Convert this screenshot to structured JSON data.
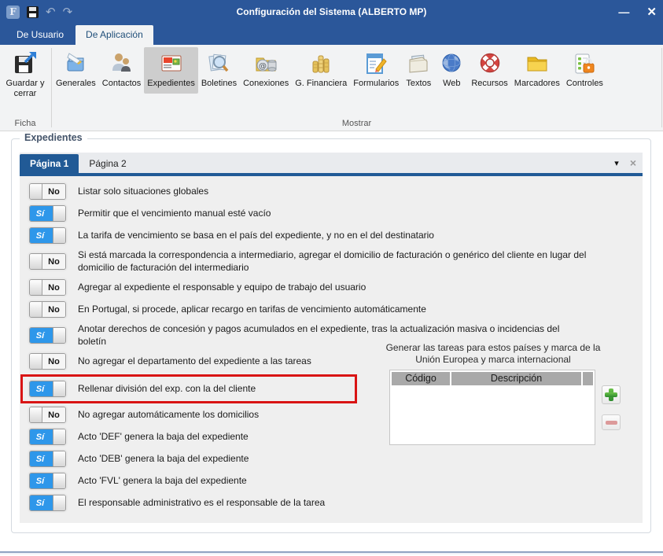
{
  "window": {
    "title": "Configuración del Sistema (ALBERTO MP)",
    "app_logo_glyph": "F",
    "undo_glyph": "↶",
    "redo_glyph": "↷",
    "minimize_glyph": "—",
    "close_glyph": "✕"
  },
  "ribbon_tabs": [
    {
      "label": "De Usuario",
      "active": false
    },
    {
      "label": "De Aplicación",
      "active": true
    }
  ],
  "ribbon": {
    "ficha_group": {
      "group_label": "Ficha",
      "button_label": "Guardar y cerrar",
      "button_icon": "save-close-icon"
    },
    "show_group": {
      "group_label": "Mostrar",
      "buttons": [
        {
          "label": "Generales",
          "icon": "notes-icon",
          "selected": false
        },
        {
          "label": "Contactos",
          "icon": "people-icon",
          "selected": false
        },
        {
          "label": "Expedientes",
          "icon": "card-icon",
          "selected": true
        },
        {
          "label": "Boletines",
          "icon": "magnifier-icon",
          "selected": false
        },
        {
          "label": "Conexiones",
          "icon": "connection-icon",
          "selected": false
        },
        {
          "label": "G. Financiera",
          "icon": "coins-icon",
          "selected": false
        },
        {
          "label": "Formularios",
          "icon": "form-icon",
          "selected": false
        },
        {
          "label": "Textos",
          "icon": "texts-icon",
          "selected": false
        },
        {
          "label": "Web",
          "icon": "globe-icon",
          "selected": false
        },
        {
          "label": "Recursos",
          "icon": "lifesaver-icon",
          "selected": false
        },
        {
          "label": "Marcadores",
          "icon": "folder-icon",
          "selected": false
        },
        {
          "label": "Controles",
          "icon": "lock-list-icon",
          "selected": false
        }
      ]
    }
  },
  "panel": {
    "title": "Expedientes",
    "page_tabs": [
      {
        "label": "Página 1",
        "active": true
      },
      {
        "label": "Página 2",
        "active": false
      }
    ],
    "tab_menu_glyph": "▾",
    "tab_close_glyph": "×",
    "settings": [
      {
        "state": "No",
        "label": "Listar solo situaciones globales",
        "highlighted": false
      },
      {
        "state": "Sí",
        "label": "Permitir que el vencimiento manual esté vacío",
        "highlighted": false
      },
      {
        "state": "Sí",
        "label": "La tarifa de vencimiento se basa en el país del expediente, y no en el del destinatario",
        "highlighted": false
      },
      {
        "state": "No",
        "label": "Si está marcada la correspondencia a intermediario, agregar el domicilio de facturación o genérico del cliente en lugar del domicilio de facturación del intermediario",
        "highlighted": false
      },
      {
        "state": "No",
        "label": "Agregar al expediente el responsable y equipo de trabajo del usuario",
        "highlighted": false
      },
      {
        "state": "No",
        "label": "En Portugal, si procede, aplicar recargo en tarifas de vencimiento automáticamente",
        "highlighted": false
      },
      {
        "state": "Sí",
        "label": "Anotar derechos de concesión y pagos acumulados en el expediente, tras la actualización masiva o incidencias del boletín",
        "highlighted": false
      },
      {
        "state": "No",
        "label": "No agregar el departamento del expediente a las tareas",
        "highlighted": false
      },
      {
        "state": "Sí",
        "label": "Rellenar división del exp. con la del cliente",
        "highlighted": true
      },
      {
        "state": "No",
        "label": "No agregar automáticamente los domicilios",
        "highlighted": false
      },
      {
        "state": "Sí",
        "label": "Acto 'DEF' genera la baja del expediente",
        "highlighted": false
      },
      {
        "state": "Sí",
        "label": "Acto 'DEB' genera la baja del expediente",
        "highlighted": false
      },
      {
        "state": "Sí",
        "label": "Acto 'FVL' genera la baja del expediente",
        "highlighted": false
      },
      {
        "state": "Sí",
        "label": "El responsable administrativo es el responsable de la tarea",
        "highlighted": false
      }
    ],
    "tasks_box": {
      "caption": "Generar las tareas para estos países y marca de la Unión Europea y marca internacional",
      "headers": [
        "Código",
        "Descripción"
      ],
      "rows": [],
      "add_label": "+",
      "remove_label": "−"
    }
  }
}
